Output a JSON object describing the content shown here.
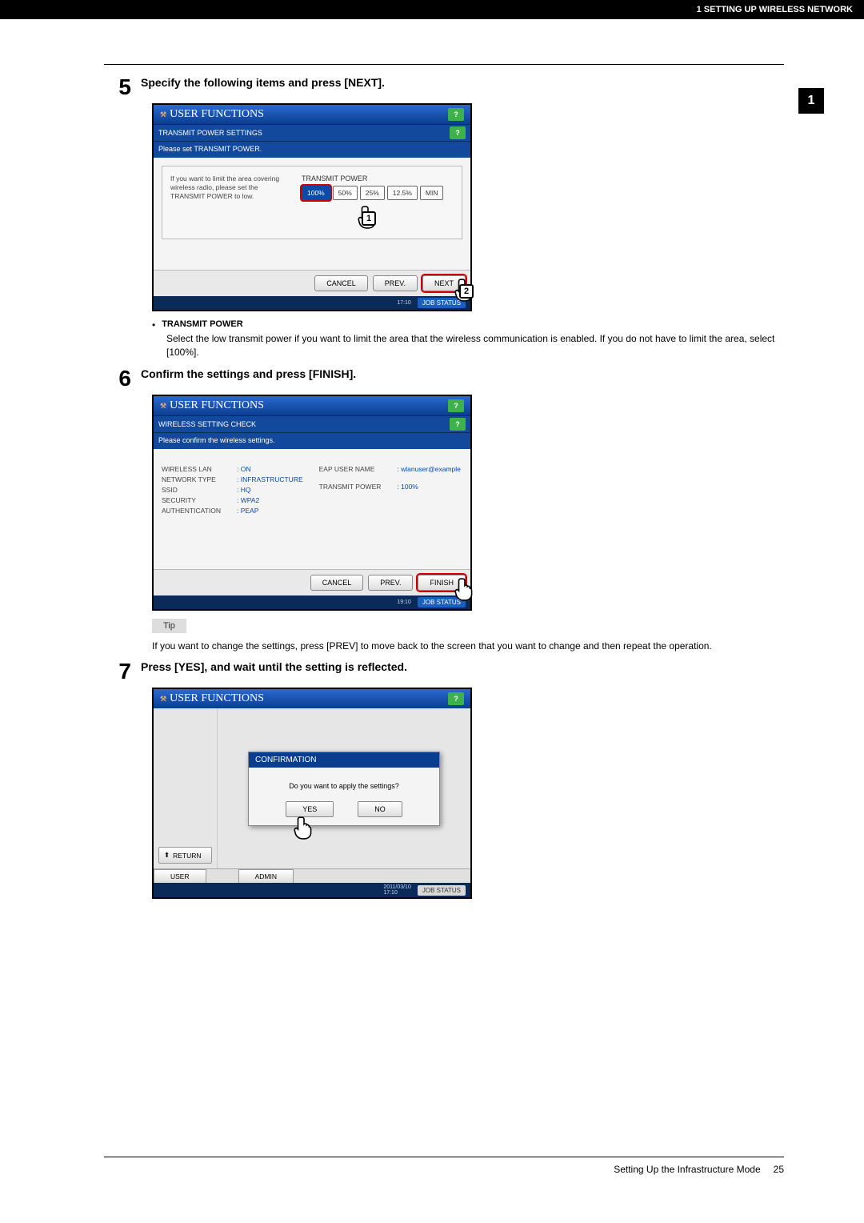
{
  "header": {
    "section": "1 SETTING UP WIRELESS NETWORK"
  },
  "side_tab": "1",
  "steps": {
    "s5": {
      "num": "5",
      "title": "Specify the following items and press [NEXT].",
      "bullet_title": "TRANSMIT POWER",
      "bullet_desc": "Select the low transmit power if you want to limit the area that the wireless communication is enabled. If you do not have to limit the area, select [100%]."
    },
    "s6": {
      "num": "6",
      "title": "Confirm the settings and press [FINISH].",
      "tip_label": "Tip",
      "tip_text": "If you want to change the settings, press [PREV] to move back to the screen that you want to change and then repeat the operation."
    },
    "s7": {
      "num": "7",
      "title": "Press [YES], and wait until the setting is reflected."
    }
  },
  "panel_common": {
    "header_title": "USER FUNCTIONS",
    "help": "?",
    "cancel": "CANCEL",
    "prev": "PREV.",
    "job_status": "JOB STATUS"
  },
  "panel1": {
    "subtitle": "TRANSMIT POWER SETTINGS",
    "instruction": "Please set TRANSMIT POWER.",
    "left_note": "If you want to limit the area covering wireless radio, please set the TRANSMIT POWER to low.",
    "label": "TRANSMIT POWER",
    "options": [
      "100%",
      "50%",
      "25%",
      "12.5%",
      "MIN"
    ],
    "next": "NEXT",
    "time": "17:10",
    "callout1": "1",
    "callout2": "2"
  },
  "panel2": {
    "subtitle": "WIRELESS SETTING CHECK",
    "instruction": "Please confirm the wireless settings.",
    "rows_left": [
      {
        "k": "WIRELESS LAN",
        "v": ": ON"
      },
      {
        "k": "NETWORK TYPE",
        "v": ": INFRASTRUCTURE"
      },
      {
        "k": "SSID",
        "v": ": HQ"
      },
      {
        "k": "SECURITY",
        "v": ": WPA2"
      },
      {
        "k": "AUTHENTICATION",
        "v": ": PEAP"
      }
    ],
    "rows_right": [
      {
        "k": "EAP USER NAME",
        "v": ": wlanuser@example"
      },
      {
        "k": "TRANSMIT POWER",
        "v": ": 100%"
      }
    ],
    "finish": "FINISH",
    "time": "19:10"
  },
  "panel3": {
    "modal_title": "CONFIRMATION",
    "question": "Do you want to apply the settings?",
    "yes": "YES",
    "no": "NO",
    "return": "RETURN",
    "user_tab": "USER",
    "admin_tab": "ADMIN",
    "date": "2011/03/10",
    "time": "17:10"
  },
  "footer": {
    "text": "Setting Up the Infrastructure Mode",
    "page": "25"
  }
}
